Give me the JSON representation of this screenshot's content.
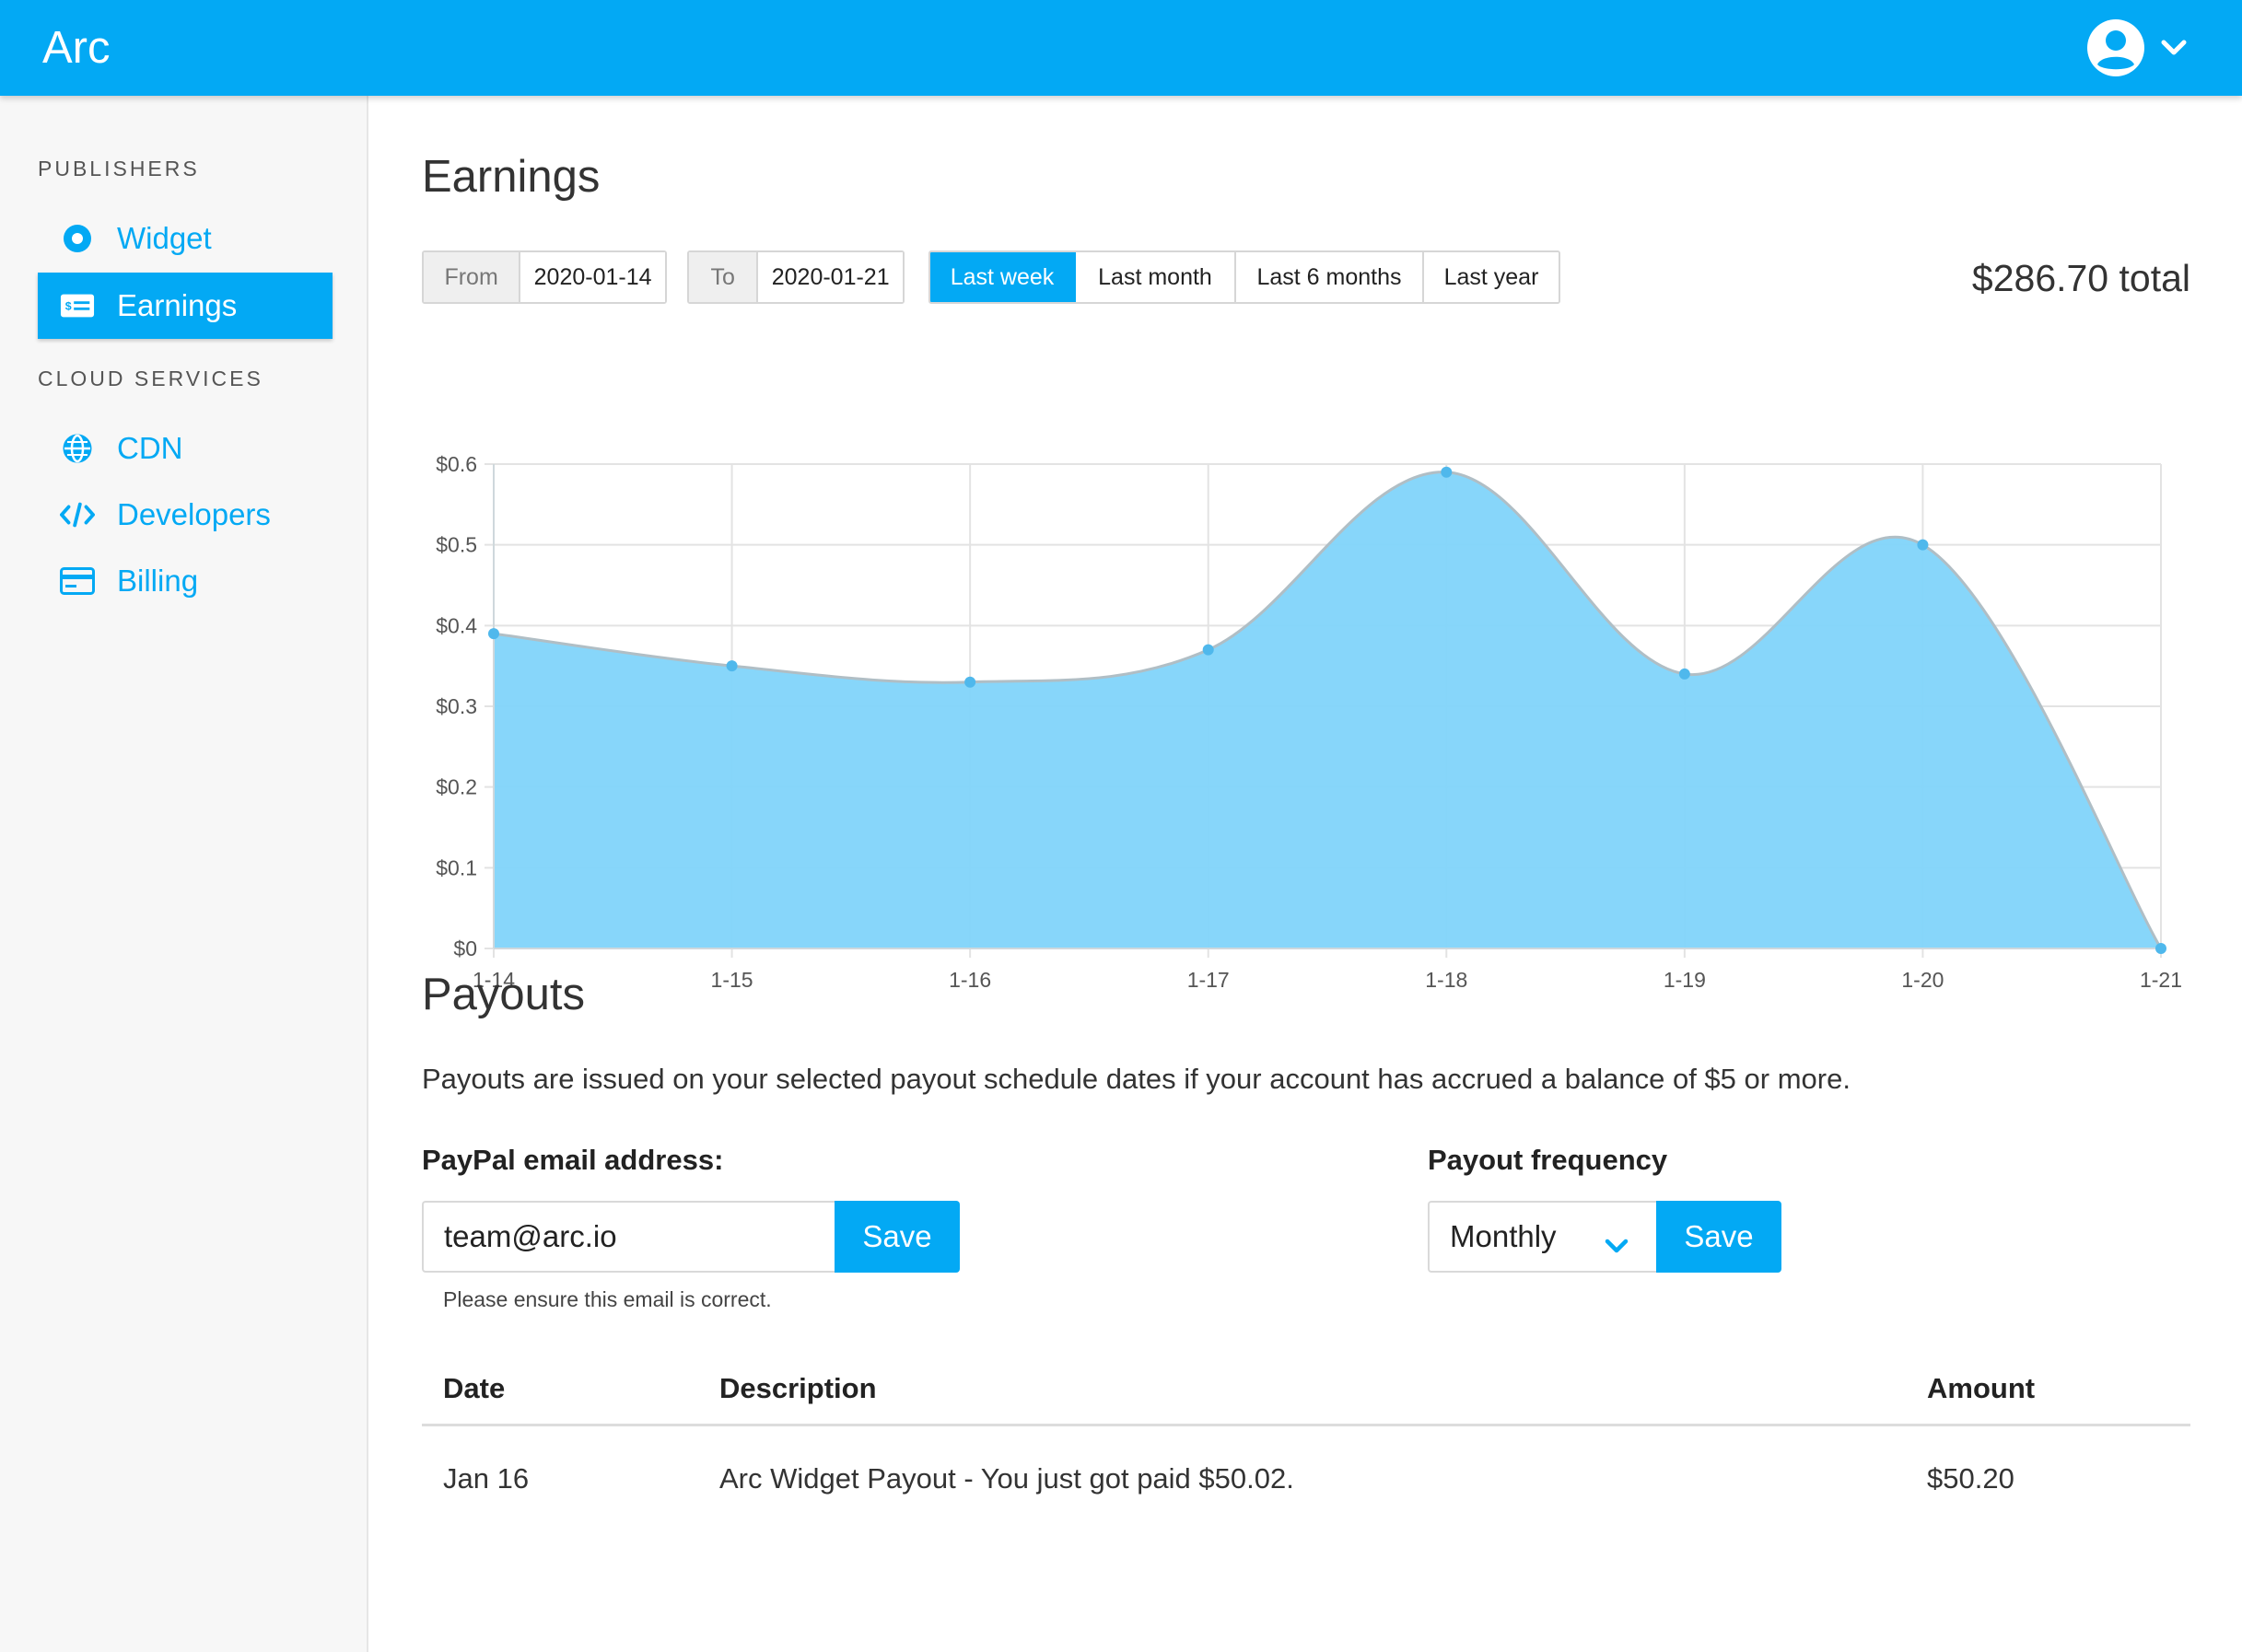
{
  "app": {
    "title": "Arc"
  },
  "header": {
    "user_icon": "account-circle-icon",
    "dropdown_icon": "chevron-down-icon"
  },
  "sidebar": {
    "sections": [
      {
        "heading": "PUBLISHERS",
        "items": [
          {
            "label": "Widget",
            "icon": "radio-icon"
          },
          {
            "label": "Earnings",
            "icon": "money-icon",
            "active": true
          }
        ]
      },
      {
        "heading": "CLOUD SERVICES",
        "items": [
          {
            "label": "CDN",
            "icon": "globe-icon"
          },
          {
            "label": "Developers",
            "icon": "code-icon"
          },
          {
            "label": "Billing",
            "icon": "credit-card-icon"
          }
        ]
      }
    ]
  },
  "earnings": {
    "title": "Earnings",
    "from_label": "From",
    "from_value": "2020-01-14",
    "to_label": "To",
    "to_value": "2020-01-21",
    "ranges": [
      "Last week",
      "Last month",
      "Last 6 months",
      "Last year"
    ],
    "active_range": "Last week",
    "total": "$286.70 total"
  },
  "chart_data": {
    "type": "area",
    "x": [
      "1-14",
      "1-15",
      "1-16",
      "1-17",
      "1-18",
      "1-19",
      "1-20",
      "1-21"
    ],
    "series": [
      {
        "values": [
          0.39,
          0.35,
          0.33,
          0.37,
          0.59,
          0.34,
          0.5,
          0.0
        ]
      }
    ],
    "yticks": [
      "$0",
      "$0.1",
      "$0.2",
      "$0.3",
      "$0.4",
      "$0.5",
      "$0.6"
    ],
    "ylim": [
      0,
      0.6
    ],
    "grid": true,
    "fill_color": "#81d4fa",
    "line_color": "#b0bec5",
    "point_color": "#4fb8ec"
  },
  "payouts": {
    "title": "Payouts",
    "description": "Payouts are issued on your selected payout schedule dates if your account has accrued a balance of $5 or more.",
    "paypal_label": "PayPal email address:",
    "paypal_value": "team@arc.io",
    "paypal_save": "Save",
    "paypal_help": "Please ensure this email is correct.",
    "frequency_label": "Payout frequency",
    "frequency_value": "Monthly",
    "frequency_save": "Save",
    "table": {
      "headers": [
        "Date",
        "Description",
        "Amount"
      ],
      "rows": [
        [
          "Jan 16",
          "Arc Widget Payout - You just got paid $50.02.",
          "$50.20"
        ]
      ]
    }
  },
  "colors": {
    "primary": "#03a9f4",
    "sidebar_bg": "#f7f7f7"
  }
}
